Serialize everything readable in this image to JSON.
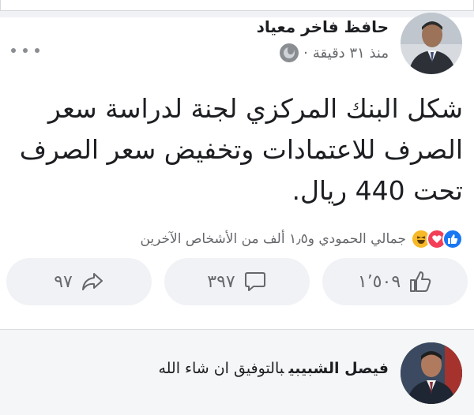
{
  "post": {
    "author_name": "حافظ فاخر معياد",
    "timestamp": "منذ ٣١ دقيقة",
    "separator": "·",
    "audience_icon": "globe-icon",
    "more_icon": "more-options-icon",
    "text": "شكل البنك المركزي لجنة لدراسة سعر الصرف للاعتمادات وتخفيض سعر الصرف تحت 440 ريال."
  },
  "reactions": {
    "icons": [
      "like-icon",
      "love-icon",
      "haha-icon"
    ],
    "summary": "جمالي الحمودي و١٫٥ ألف من الأشخاص الآخرين"
  },
  "actions": {
    "like_count": "١٬٥٠٩",
    "comment_count": "٣٩٧",
    "share_count": "٩٧"
  },
  "comment": {
    "author": "فيصل الشبيبي",
    "text": "بالتوفيق ان شاء الله"
  },
  "colors": {
    "brand_blue": "#1877f2",
    "love_red": "#f33e58",
    "haha_yellow": "#f7b928",
    "muted_text": "#65676b",
    "button_bg": "#f0f2f5"
  }
}
